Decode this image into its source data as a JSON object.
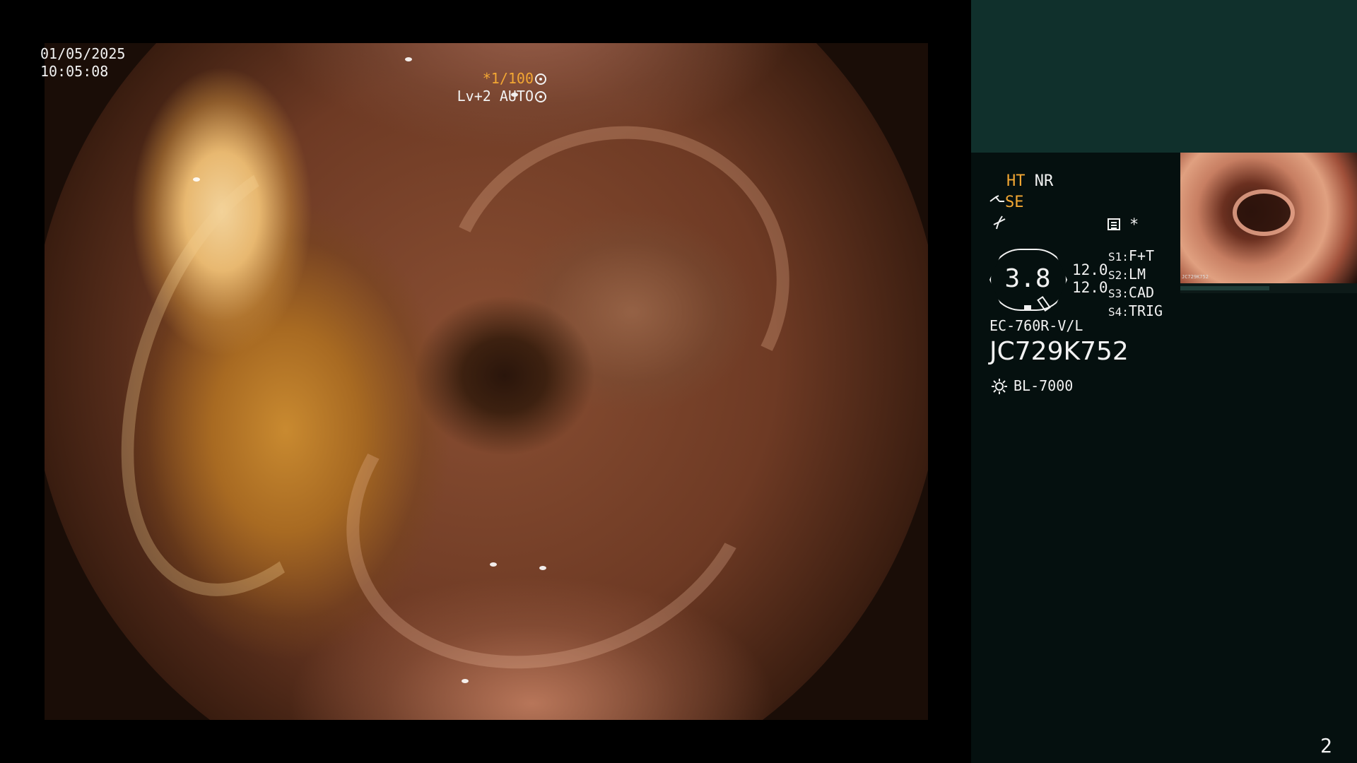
{
  "overlay": {
    "date": "01/05/2025",
    "time": "10:05:08",
    "shutter": "*1/100",
    "shutter_icon": "aperture-icon",
    "level": "Lv+2 AUTO",
    "level_icon": "iris-icon"
  },
  "panel": {
    "mode_ht": "HT",
    "mode_nr": "NR",
    "se": "SE",
    "se_icon": "scope-tip-icon",
    "wave_icon": "wave-icon",
    "menu_icon": "menu-list-icon",
    "star": "*",
    "zoom": "3.8",
    "levels": [
      "12.0",
      "12.0"
    ],
    "switches": [
      {
        "key": "S1:",
        "value": "F+T"
      },
      {
        "key": "S2:",
        "value": "LM"
      },
      {
        "key": "S3:",
        "value": "CAD"
      },
      {
        "key": "S4:",
        "value": "TRIG"
      }
    ],
    "scope_model": "EC-760R-V/L",
    "serial": "JC729K752",
    "light_source": "BL-7000",
    "light_icon": "sun-icon",
    "thumbnail_caption": "JC729K752",
    "page_number": "2"
  },
  "colors": {
    "accent_orange": "#f3a733",
    "panel_bg": "#05100f",
    "panel_band": "#10302c",
    "text": "#f2f2f2"
  }
}
